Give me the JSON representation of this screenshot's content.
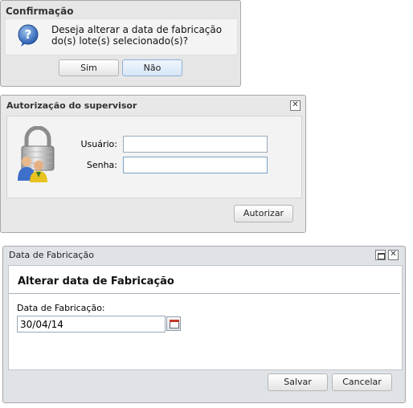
{
  "confirm_dialog": {
    "title": "Confirmação",
    "message": "Deseja alterar a data de fabricação do(s) lote(s) selecionado(s)?",
    "yes_label": "Sim",
    "no_label": "Não",
    "icon": "question-icon"
  },
  "supervisor_dialog": {
    "title": "Autorização do supervisor",
    "close_symbol": "✕",
    "username_label": "Usuário:",
    "username_value": "",
    "password_label": "Senha:",
    "password_value": "",
    "authorize_label": "Autorizar",
    "icon": "lock-users-icon"
  },
  "manufacture_dialog": {
    "title": "Data de Fabricação",
    "close_symbol": "✕",
    "heading": "Alterar data de Fabricação",
    "date_label": "Data de Fabricação:",
    "date_value": "30/04/14",
    "save_label": "Salvar",
    "cancel_label": "Cancelar"
  },
  "colors": {
    "dialog_bg": "#e6e6e6",
    "accent_border": "#8eb0d4",
    "question_icon": "#3a6fc4"
  }
}
